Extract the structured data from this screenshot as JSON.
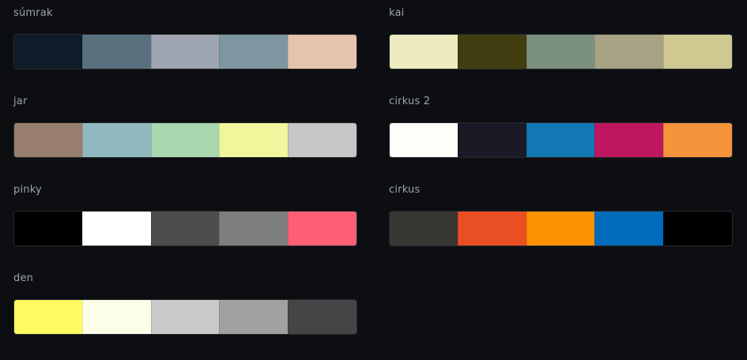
{
  "palettes": [
    {
      "name": "súmrak",
      "colors": [
        "#0e1c29",
        "#59707f",
        "#9ea4b0",
        "#7e96a0",
        "#e4c4ad"
      ]
    },
    {
      "name": "kai",
      "colors": [
        "#edebc0",
        "#413d10",
        "#7b9080",
        "#a6a283",
        "#d0c891"
      ]
    },
    {
      "name": "jar",
      "colors": [
        "#987f6d",
        "#90b9bf",
        "#a9d6ad",
        "#f1f59b",
        "#c6c6c6"
      ]
    },
    {
      "name": "cirkus 2",
      "colors": [
        "#fbfff8",
        "#191a25",
        "#1379b4",
        "#bf175f",
        "#f5943b"
      ]
    },
    {
      "name": "pinky",
      "colors": [
        "#000000",
        "#ffffff",
        "#4c4c4c",
        "#7f7e7e",
        "#ff5f75"
      ]
    },
    {
      "name": "cirkus",
      "colors": [
        "#363632",
        "#ea4e23",
        "#ff9200",
        "#006cbb",
        "#000000"
      ]
    },
    {
      "name": "den",
      "colors": [
        "#fffa61",
        "#fcfee8",
        "#cacaca",
        "#a1a1a1",
        "#454545"
      ]
    }
  ]
}
